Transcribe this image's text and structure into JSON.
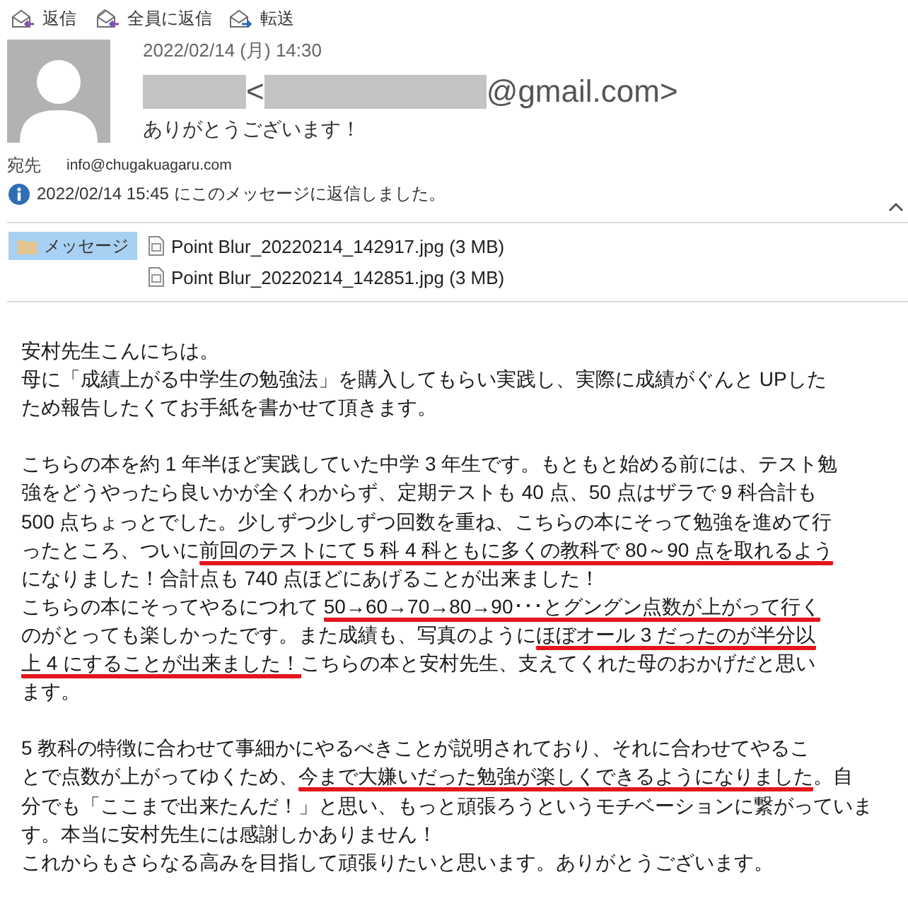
{
  "toolbar": [
    {
      "label": "返信",
      "kind": "reply"
    },
    {
      "label": "全員に返信",
      "kind": "reply_all"
    },
    {
      "label": "転送",
      "kind": "forward"
    }
  ],
  "message": {
    "date": "2022/02/14 (月) 14:30",
    "sender": [
      {
        "kind": "redacted_name"
      },
      {
        "kind": "text",
        "text": "<"
      },
      {
        "kind": "redacted_address"
      },
      {
        "kind": "text",
        "text": "@gmail.com>"
      }
    ],
    "subject": "ありがとうございます！",
    "to_label": "宛先",
    "to": "info@chugakuagaru.com",
    "info": "2022/02/14 15:45 にこのメッセージに返信しました。"
  },
  "attachments": {
    "message_tab": {
      "label": "メッセージ",
      "selected": true
    },
    "files": [
      {
        "name": "Point Blur_20220214_142917.jpg (3 MB)",
        "selected": false
      },
      {
        "name": "Point Blur_20220214_142851.jpg (3 MB)",
        "selected": false
      }
    ]
  },
  "body": {
    "paragraphs": [
      {
        "lines": [
          [
            {
              "text": "安村先生こんにちは。",
              "underlined": false
            }
          ],
          [
            {
              "text": "母に「成績上がる中学生の勉強法」を購入してもらい実践し、実際に成績がぐんと UPした",
              "underlined": false
            }
          ],
          [
            {
              "text": "ため報告したくてお手紙を書かせて頂きます。",
              "underlined": false
            }
          ]
        ]
      },
      {
        "lines": [
          [
            {
              "text": "こちらの本を約 1 年半ほど実践していた中学 3 年生です。もともと始める前には、テスト勉",
              "underlined": false
            }
          ],
          [
            {
              "text": "強をどうやったら良いかが全くわからず、定期テストも 40 点、50 点はザラで 9 科合計も",
              "underlined": false
            }
          ],
          [
            {
              "text": "500 点ちょっとでした。少しずつ少しずつ回数を重ね、こちらの本にそって勉強を進めて行",
              "underlined": false
            }
          ],
          [
            {
              "text": "ったところ、ついに",
              "underlined": false
            },
            {
              "text": "前回のテストにて 5 科 4 科ともに多くの教科で 80～90 点を取れるよう",
              "underlined": true
            }
          ],
          [
            {
              "text": "になりました！合計点も 740 点ほどにあげることが出来ました！",
              "underlined": false
            }
          ],
          [
            {
              "text": "こちらの本にそってやるにつれて ",
              "underlined": false
            },
            {
              "text": "50→60→70→80→90･･･とグングン点数が上がって行く",
              "underlined": true
            }
          ],
          [
            {
              "text": "のがとっても楽しかったです。また成績も、写真のように",
              "underlined": false
            },
            {
              "text": "ほぼオール 3 だったのが半分以",
              "underlined": true
            }
          ],
          [
            {
              "text": "上 4 にすることが出来ました！",
              "underlined": true
            },
            {
              "text": "こちらの本と安村先生、支えてくれた母のおかげだと思い",
              "underlined": false
            }
          ],
          [
            {
              "text": "ます。",
              "underlined": false
            }
          ]
        ]
      },
      {
        "lines": [
          [
            {
              "text": "5 教科の特徴に合わせて事細かにやるべきことが説明されており、それに合わせてやるこ",
              "underlined": false
            }
          ],
          [
            {
              "text": "とで点数が上がってゆくため、",
              "underlined": false
            },
            {
              "text": "今まで大嫌いだった勉強が楽しくできるようになりました",
              "underlined": true
            },
            {
              "text": "。自",
              "underlined": false
            }
          ],
          [
            {
              "text": "分でも「ここまで出来たんだ！」と思い、もっと頑張ろうというモチベーションに繋がっていま",
              "underlined": false
            }
          ],
          [
            {
              "text": "す。本当に安村先生には感謝しかありません！",
              "underlined": false
            }
          ],
          [
            {
              "text": "これからもさらなる高みを目指して頑張りたいと思います。ありがとうございます。",
              "underlined": false
            }
          ]
        ]
      }
    ]
  }
}
